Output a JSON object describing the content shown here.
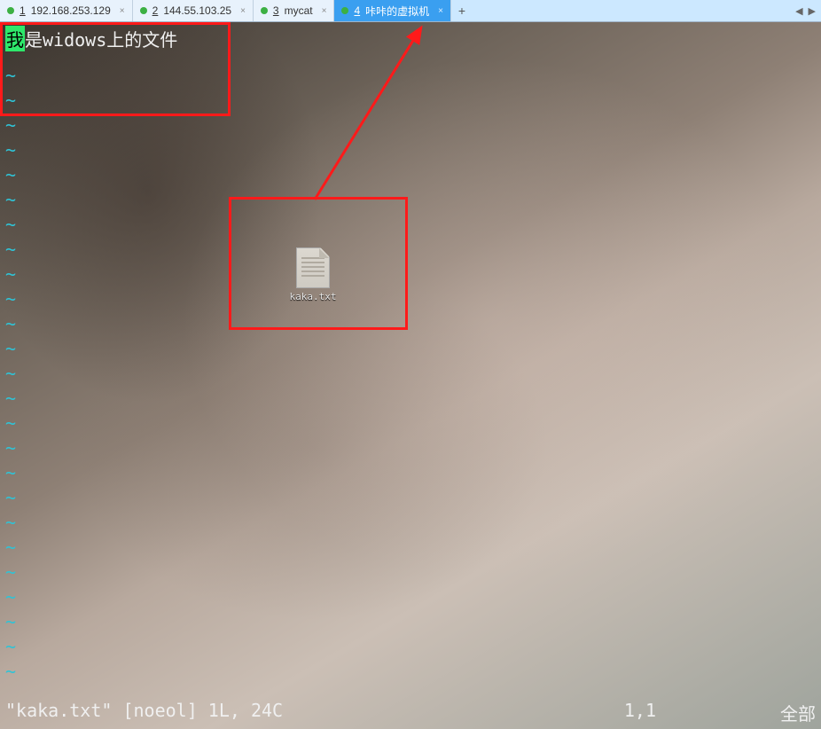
{
  "tabs": [
    {
      "num": "1",
      "label": "192.168.253.129"
    },
    {
      "num": "2",
      "label": "144.55.103.25"
    },
    {
      "num": "3",
      "label": "mycat"
    },
    {
      "num": "4",
      "label": "咔咔的虚拟机"
    }
  ],
  "active_tab_index": 3,
  "editor": {
    "first_char": "我",
    "rest_line": "是widows上的文件",
    "tilde": "~"
  },
  "status": {
    "left": "\"kaka.txt\" [noeol] 1L, 24C",
    "pos": "1,1",
    "all": "全部"
  },
  "desktop_file": {
    "name": "kaka.txt"
  },
  "colors": {
    "accent": "#3a9ff0",
    "cursor": "#2ee86b",
    "tilde": "#2fc3d6",
    "annotation": "#ff1a1a"
  }
}
